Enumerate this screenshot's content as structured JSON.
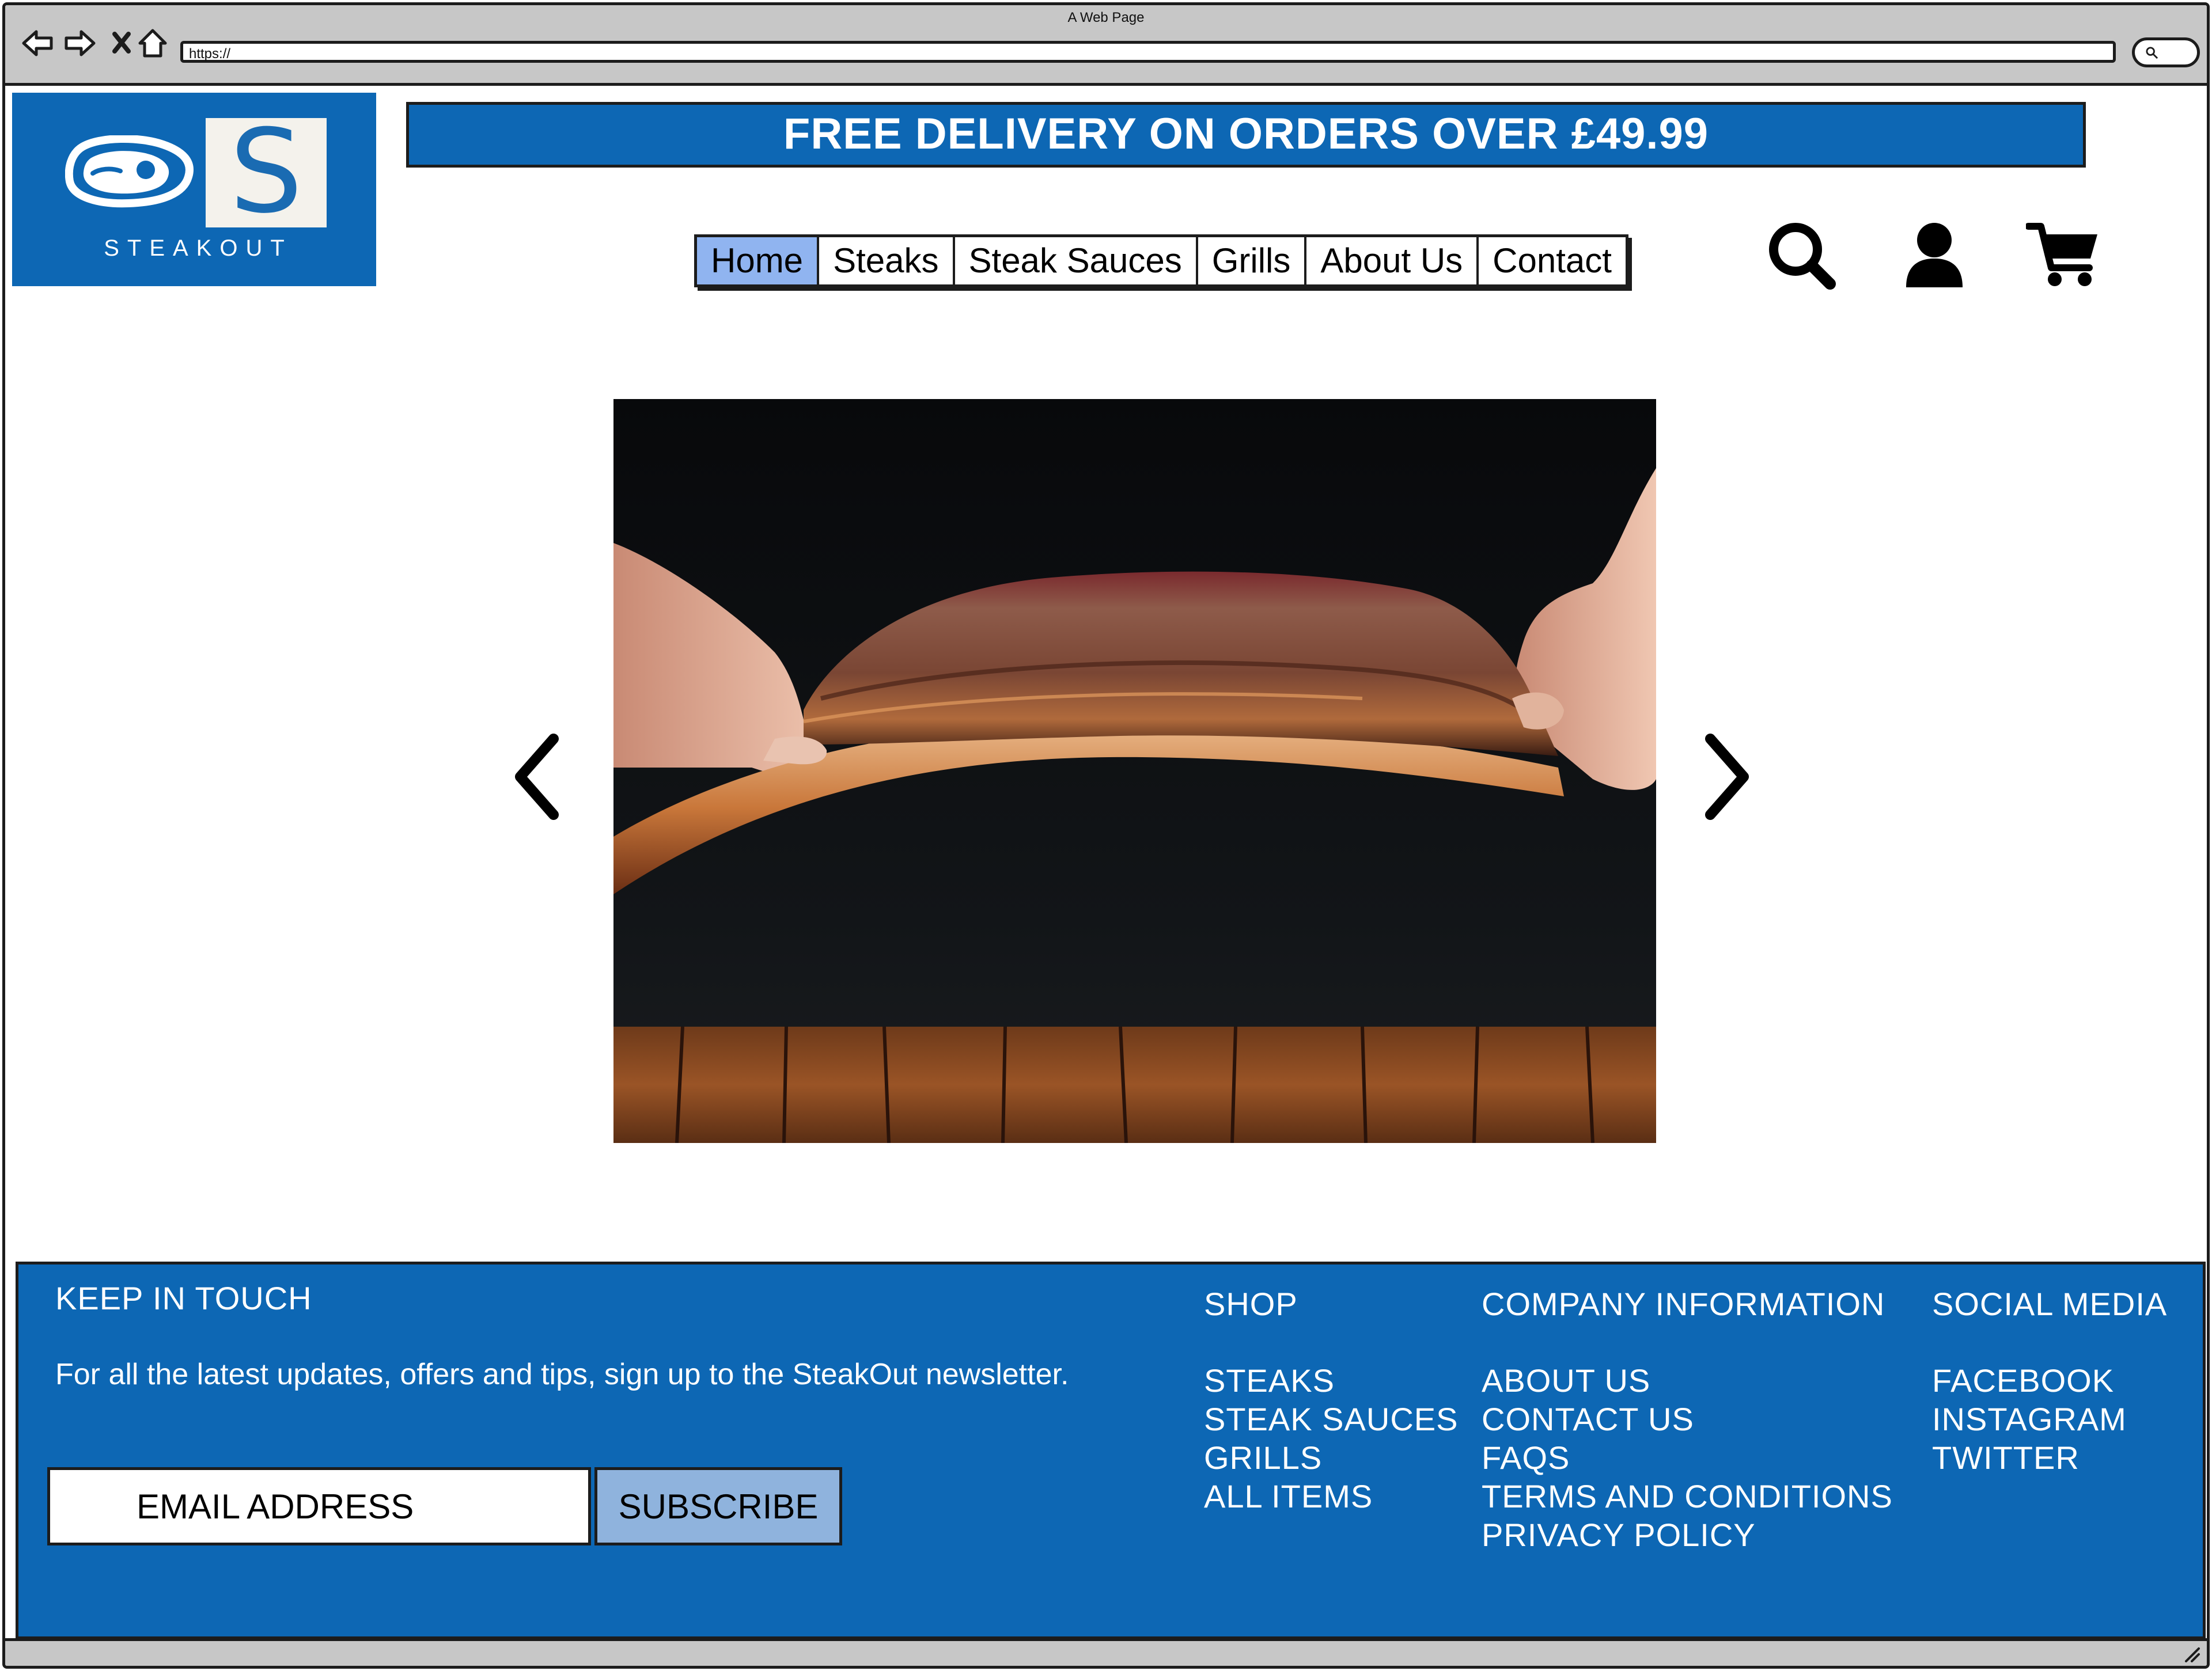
{
  "browser": {
    "window_title": "A Web Page",
    "url": "https://"
  },
  "brand": {
    "logo_letter": "S",
    "logo_text": "STEAKOUT",
    "primary_color": "#0d67b4",
    "active_nav_color": "#90b4f0"
  },
  "promo": {
    "text": "FREE DELIVERY ON ORDERS OVER £49.99"
  },
  "nav": {
    "items": [
      {
        "label": "Home",
        "active": true
      },
      {
        "label": "Steaks"
      },
      {
        "label": "Steak Sauces"
      },
      {
        "label": "Grills"
      },
      {
        "label": "About Us"
      },
      {
        "label": "Contact"
      }
    ]
  },
  "header_icons": [
    "search-icon",
    "account-icon",
    "cart-icon"
  ],
  "hero": {
    "image": "photo: hands holding a smoked beef rib over a wooden table"
  },
  "footer": {
    "newsletter": {
      "heading": "KEEP IN TOUCH",
      "text": "For all the latest updates, offers and tips, sign up to the SteakOut newsletter.",
      "email_placeholder": "EMAIL ADDRESS",
      "subscribe_label": "SUBSCRIBE"
    },
    "shop": {
      "heading": "SHOP",
      "links": [
        "STEAKS",
        "STEAK SAUCES",
        "GRILLS",
        "ALL ITEMS"
      ]
    },
    "company": {
      "heading": "COMPANY INFORMATION",
      "links": [
        "ABOUT US",
        "CONTACT US",
        "FAQS",
        "TERMS AND CONDITIONS",
        "PRIVACY POLICY"
      ]
    },
    "social": {
      "heading": "SOCIAL MEDIA",
      "links": [
        "FACEBOOK",
        "INSTAGRAM",
        "TWITTER"
      ]
    }
  }
}
